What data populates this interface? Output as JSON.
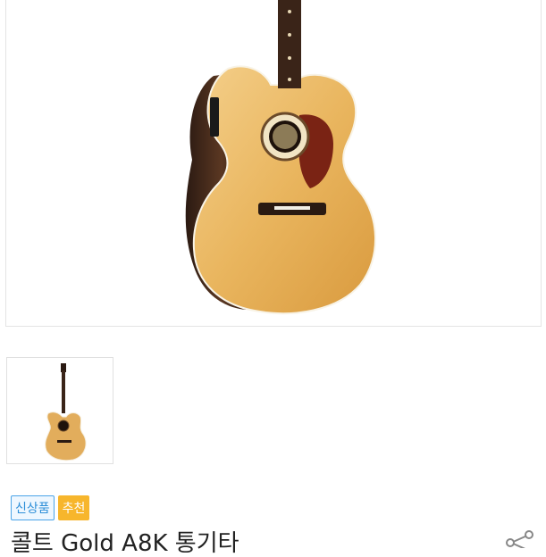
{
  "product": {
    "title": "콜트 Gold A8K 통기타"
  },
  "badges": {
    "new": "신상품",
    "recommended": "추천"
  },
  "icons": {
    "share": "share-icon"
  },
  "colors": {
    "new_badge": "#2e8fd8",
    "recommended_badge": "#f7b62c"
  }
}
